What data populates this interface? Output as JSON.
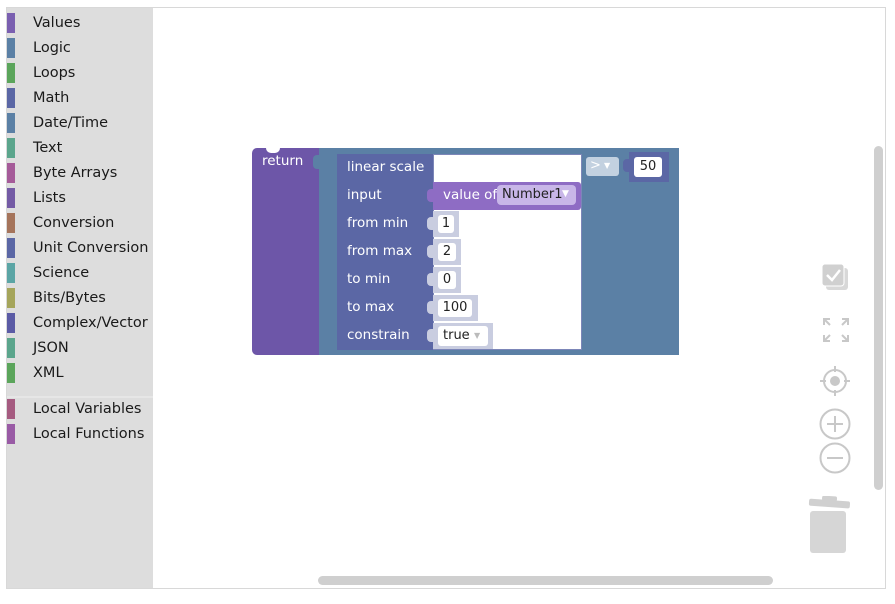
{
  "toolbox": {
    "categories": [
      {
        "label": "Values",
        "color": "#7a5fb0"
      },
      {
        "label": "Logic",
        "color": "#5b80a5"
      },
      {
        "label": "Loops",
        "color": "#5ba55b"
      },
      {
        "label": "Math",
        "color": "#5b67a5"
      },
      {
        "label": "Date/Time",
        "color": "#5b80a5"
      },
      {
        "label": "Text",
        "color": "#5ba58c"
      },
      {
        "label": "Byte Arrays",
        "color": "#a55b99"
      },
      {
        "label": "Lists",
        "color": "#745ba5"
      },
      {
        "label": "Conversion",
        "color": "#a5745b"
      },
      {
        "label": "Unit Conversion",
        "color": "#5b67a5"
      },
      {
        "label": "Science",
        "color": "#5ba5a5"
      },
      {
        "label": "Bits/Bytes",
        "color": "#a5a55b"
      },
      {
        "label": "Complex/Vector",
        "color": "#5b5ba5"
      },
      {
        "label": "JSON",
        "color": "#5ba58c"
      },
      {
        "label": "XML",
        "color": "#5ba55b"
      }
    ],
    "local": [
      {
        "label": "Local Variables",
        "color": "#a55b80"
      },
      {
        "label": "Local Functions",
        "color": "#995ba5"
      }
    ]
  },
  "blocks": {
    "return_label": "return",
    "linear_scale_label": "linear scale",
    "input_label": "input",
    "from_min_label": "from min",
    "from_max_label": "from max",
    "to_min_label": "to min",
    "to_max_label": "to max",
    "constrain_label": "constrain",
    "value_of_label": "value of",
    "variable_name": "Number1",
    "from_min_value": "1",
    "from_max_value": "2",
    "to_min_value": "0",
    "to_max_value": "100",
    "constrain_value": "true",
    "compare_op": ">",
    "compare_value": "50"
  },
  "colors": {
    "return_block": "#6d56a8",
    "compare_block": "#5b80a5",
    "math_block": "#5b67a5",
    "value_block": "#8e6cc4",
    "logic_inputs": "#c9cde0"
  }
}
